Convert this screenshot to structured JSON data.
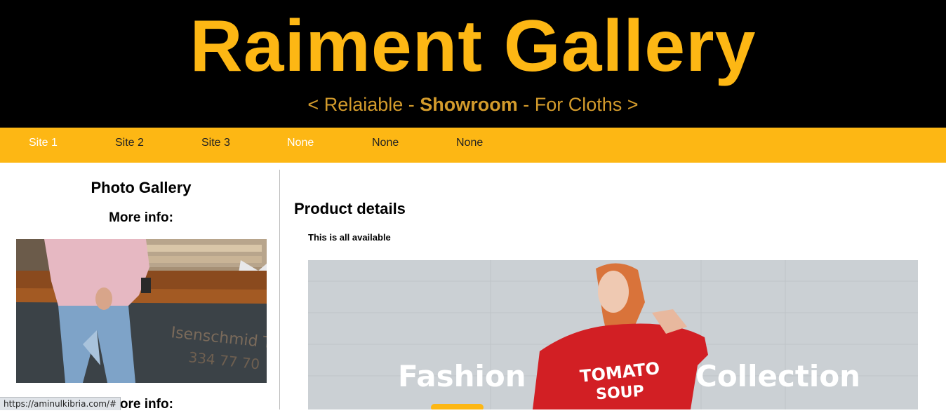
{
  "header": {
    "title": "Raiment Gallery",
    "tagline_prefix": "< Relaiable - ",
    "tagline_bold": "Showroom",
    "tagline_suffix": " - For Cloths >"
  },
  "nav": {
    "items": [
      {
        "label": "Site 1"
      },
      {
        "label": "Site 2"
      },
      {
        "label": "Site 3"
      },
      {
        "label": "None"
      },
      {
        "label": "None"
      },
      {
        "label": "None"
      }
    ]
  },
  "sidebar": {
    "title": "Photo Gallery",
    "more_info_1": "More info:",
    "more_info_2": "More info:"
  },
  "main": {
    "title": "Product details",
    "subtitle": "This is all available",
    "banner_word_left": "Fashion",
    "banner_word_right": "Collection",
    "banner_shirt_line1": "TOMATO",
    "banner_shirt_line2": "SOUP"
  },
  "status": {
    "url": "https://aminulkibria.com/#"
  },
  "colors": {
    "accent": "#fdb714",
    "header_bg": "#000000",
    "tagline": "#d39b2c"
  }
}
